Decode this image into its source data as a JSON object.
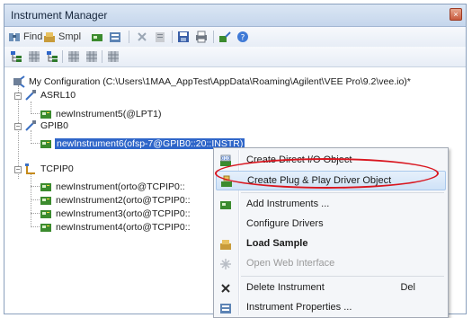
{
  "window": {
    "title": "Instrument Manager",
    "close_glyph": "×"
  },
  "toolbar1": {
    "find_label": "Find",
    "sample_label": "Smpl"
  },
  "toolbar2_icons": [
    "tree-icon",
    "grid-icon",
    "tree-add-icon",
    "grid-icon",
    "grid-icon",
    "grid-icon"
  ],
  "tree": {
    "root": "My Configuration (C:\\Users\\1MAA_AppTest\\AppData\\Roaming\\Agilent\\VEE Pro\\9.2\\vee.io)*",
    "items": [
      {
        "label": "ASRL10",
        "kind": "bus"
      },
      {
        "label": "newInstrument5(@LPT1)",
        "kind": "instrument"
      },
      {
        "label": "GPIB0",
        "kind": "bus"
      },
      {
        "label": "newInstrument6(ofsp-7@GPIB0::20::INSTR)",
        "kind": "instrument",
        "selected": true
      },
      {
        "label": "TCPIP0",
        "kind": "bus"
      },
      {
        "label": "newInstrument(orto@TCPIP0::",
        "kind": "instrument"
      },
      {
        "label": "newInstrument2(orto@TCPIP0::",
        "kind": "instrument"
      },
      {
        "label": "newInstrument3(orto@TCPIP0::",
        "kind": "instrument"
      },
      {
        "label": "newInstrument4(orto@TCPIP0::",
        "kind": "instrument"
      }
    ]
  },
  "context_menu": {
    "items": [
      {
        "label": "Create Direct I/O Object",
        "icon": "direct-io-icon"
      },
      {
        "label": "Create Plug & Play Driver Object",
        "icon": "driver-icon",
        "highlighted": true
      },
      {
        "label": "Add Instruments ...",
        "icon": "add-instrument-icon"
      },
      {
        "label": "Configure Drivers",
        "icon": ""
      },
      {
        "label": "Load Sample",
        "icon": "load-sample-icon",
        "bold": true
      },
      {
        "label": "Open Web Interface",
        "icon": "web-icon",
        "disabled": true
      },
      {
        "label": "Delete Instrument",
        "icon": "delete-icon",
        "shortcut": "Del"
      },
      {
        "label": "Instrument Properties ...",
        "icon": "properties-icon"
      }
    ]
  },
  "colors": {
    "selection": "#2f66c9",
    "annotation": "#d9161f",
    "highlight": "#cfe2f7"
  }
}
